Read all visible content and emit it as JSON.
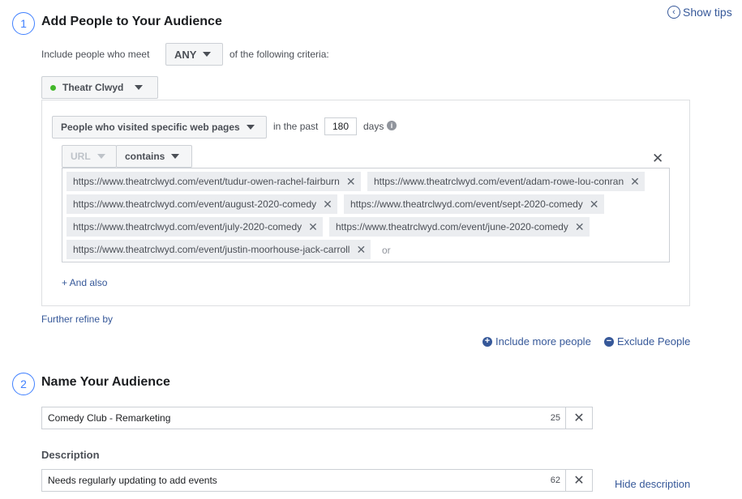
{
  "step1": {
    "number": "1",
    "title": "Add People to Your Audience"
  },
  "show_tips": {
    "label": "Show tips",
    "icon": "chevron-left-circle-icon"
  },
  "include": {
    "prefix": "Include people who meet",
    "match": "ANY",
    "suffix": "of the following criteria:"
  },
  "source": {
    "name": "Theatr Clwyd",
    "status_color": "#42b72a"
  },
  "rule": {
    "event": "People who visited specific web pages",
    "in_the_past": "in the past",
    "days_value": "180",
    "days_label": "days",
    "field": "URL",
    "operator": "contains",
    "urls": [
      "https://www.theatrclwyd.com/event/tudur-owen-rachel-fairburn",
      "https://www.theatrclwyd.com/event/adam-rowe-lou-conran",
      "https://www.theatrclwyd.com/event/august-2020-comedy",
      "https://www.theatrclwyd.com/event/sept-2020-comedy",
      "https://www.theatrclwyd.com/event/july-2020-comedy",
      "https://www.theatrclwyd.com/event/june-2020-comedy",
      "https://www.theatrclwyd.com/event/justin-moorhouse-jack-carroll"
    ],
    "or_label": "or",
    "and_also": "+ And also"
  },
  "further_refine": "Further refine by",
  "include_more": "Include more people",
  "exclude": "Exclude People",
  "step2": {
    "number": "2",
    "title": "Name Your Audience"
  },
  "audience_name": {
    "value": "Comedy Club - Remarketing",
    "remaining": "25"
  },
  "description": {
    "label": "Description",
    "value": "Needs regularly updating to add events",
    "remaining": "62"
  },
  "hide_description": "Hide description",
  "colors": {
    "link": "#365899",
    "accent": "#4080ff",
    "token_bg": "#ebedf0"
  }
}
